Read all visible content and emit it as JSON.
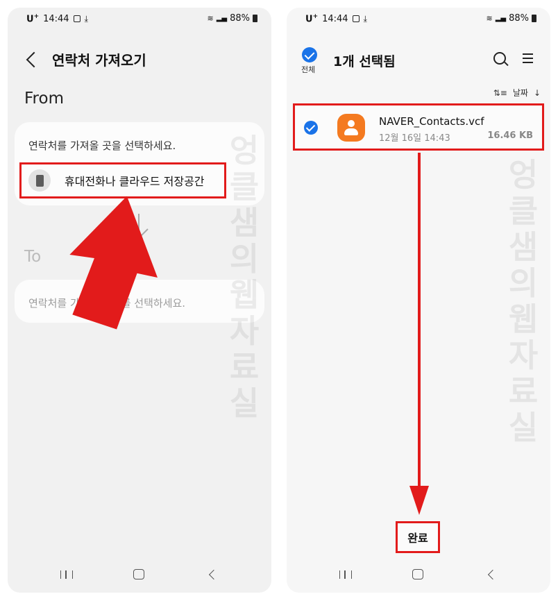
{
  "status_bar": {
    "carrier": "U",
    "carrier_sup": "+",
    "time": "14:44",
    "battery": "88%"
  },
  "left": {
    "title": "연락처 가져오기",
    "from_label": "From",
    "from_hint": "연락처를 가져올 곳을 선택하세요.",
    "source_option": "휴대전화나 클라우드 저장공간",
    "to_label": "To",
    "to_hint": "연락처를 가져올 위치를 선택하세요."
  },
  "right": {
    "select_all_label": "전체",
    "selection_title": "1개 선택됨",
    "sort_label": "날짜",
    "file": {
      "name": "NAVER_Contacts.vcf",
      "date": "12월 16일 14:43",
      "size": "16.46 KB",
      "icon_color": "#f47a20"
    },
    "done_label": "완료"
  },
  "watermark": "엉클샘의웹자료실",
  "colors": {
    "highlight": "#e21b1b",
    "accent": "#1a73e8"
  },
  "icons": [
    "back-icon",
    "phone-icon",
    "search-icon",
    "menu-icon",
    "sort-icon",
    "contact-icon",
    "download-icon",
    "image-icon",
    "wifi-icon",
    "battery-icon"
  ]
}
